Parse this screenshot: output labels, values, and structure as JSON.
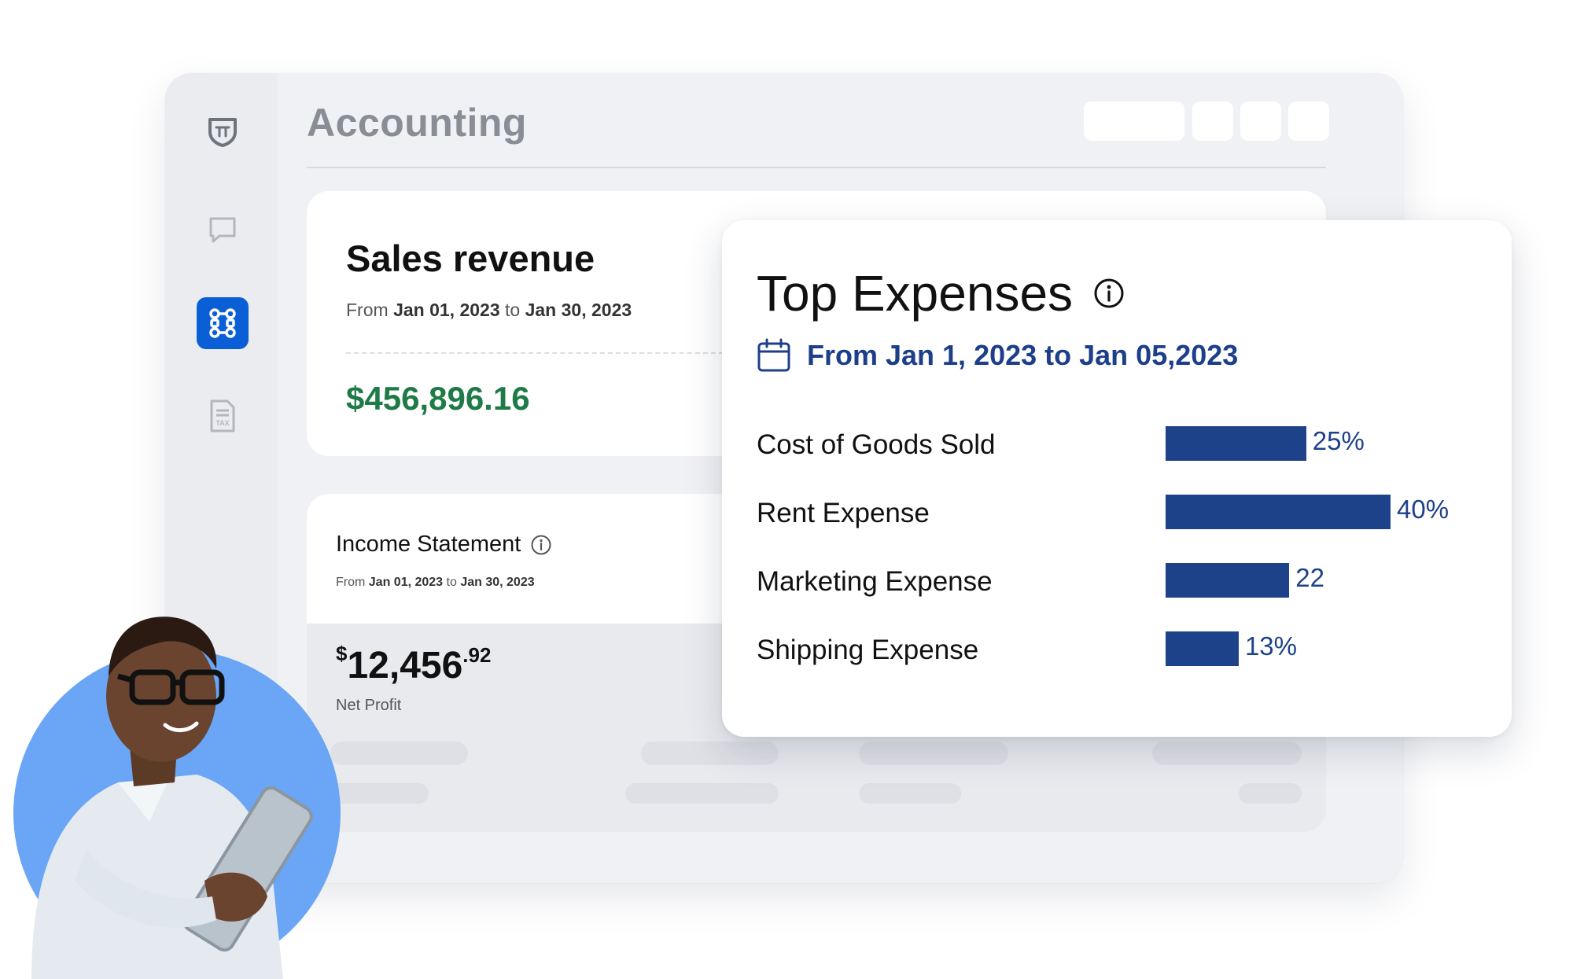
{
  "app": {
    "title": "Accounting"
  },
  "sales": {
    "title": "Sales revenue",
    "range_from_word": "From",
    "range_start": "Jan 01, 2023",
    "range_to_word": "to",
    "range_end": "Jan 30, 2023",
    "value": "$456,896.16"
  },
  "income": {
    "title": "Income Statement",
    "range_from_word": "From",
    "range_start": "Jan 01, 2023",
    "range_to_word": "to",
    "range_end": "Jan 30, 2023",
    "net_currency": "$",
    "net_whole": "12,456",
    "net_decimal": ".92",
    "net_label": "Net Profit"
  },
  "expenses": {
    "title": "Top Expenses",
    "range": "From Jan 1, 2023 to Jan 05,2023",
    "rows": [
      {
        "label": "Cost of Goods Sold",
        "value_text": "25%",
        "value": 25
      },
      {
        "label": "Rent Expense",
        "value_text": "40%",
        "value": 40
      },
      {
        "label": "Marketing Expense",
        "value_text": "22",
        "value": 22
      },
      {
        "label": "Shipping Expense",
        "value_text": "13%",
        "value": 13
      }
    ]
  },
  "chart_data": {
    "type": "bar",
    "orientation": "horizontal",
    "title": "Top Expenses",
    "categories": [
      "Cost of Goods Sold",
      "Rent Expense",
      "Marketing Expense",
      "Shipping Expense"
    ],
    "values": [
      25,
      40,
      22,
      13
    ],
    "data_labels": [
      "25%",
      "40%",
      "22",
      "13%"
    ]
  },
  "colors": {
    "accent": "#0b5fd6",
    "bar": "#1d4289",
    "date_text": "#1d3f8a",
    "positive": "#1e7a46",
    "person_circle": "#6aa6f5"
  },
  "icons": {
    "logo": "shield-pi-icon",
    "chat": "chat-bubble-icon",
    "apps": "apps-grid-icon",
    "tax": "tax-document-icon",
    "info": "info-icon",
    "calendar": "calendar-icon"
  }
}
